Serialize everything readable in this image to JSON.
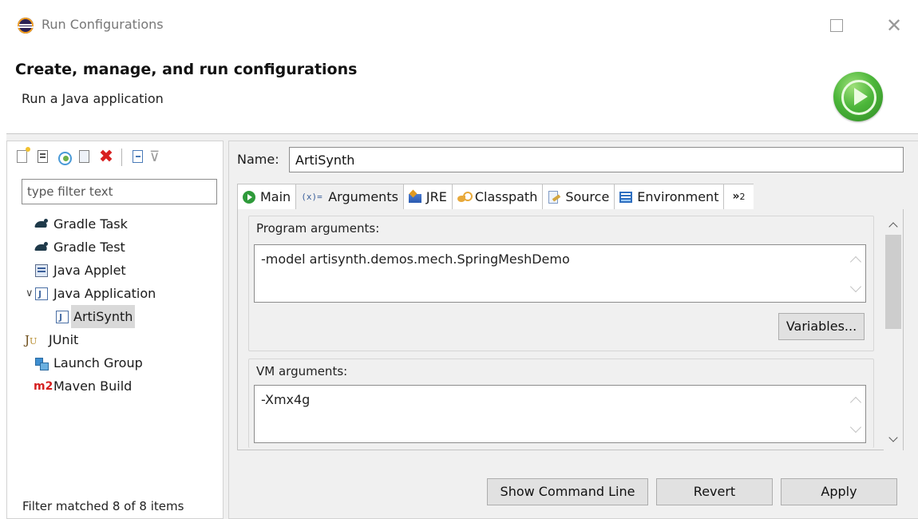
{
  "window": {
    "title": "Run Configurations",
    "maximize_icon": "maximize-icon",
    "close_label": "✕"
  },
  "header": {
    "title": "Create, manage, and run configurations",
    "subtitle": "Run a Java application",
    "icon": "run-icon"
  },
  "left": {
    "toolbar_icons": [
      "new-config-icon",
      "duplicate-icon",
      "export-icon",
      "import-icon",
      "delete-icon",
      "collapse-all-icon",
      "filter-icon"
    ],
    "delete_glyph": "✖",
    "filter_glyph": "⊽",
    "filter": {
      "placeholder": "type filter text",
      "value": ""
    },
    "tree": [
      {
        "label": "Gradle Task",
        "icon": "gradle-icon",
        "level": 1
      },
      {
        "label": "Gradle Test",
        "icon": "gradle-icon",
        "level": 1
      },
      {
        "label": "Java Applet",
        "icon": "java-applet-icon",
        "level": 1
      },
      {
        "label": "Java Application",
        "icon": "java-application-icon",
        "level": 1,
        "expanded": true
      },
      {
        "label": "ArtiSynth",
        "icon": "java-application-icon",
        "level": 2,
        "selected": true
      },
      {
        "label": "JUnit",
        "icon": "junit-icon",
        "level": 1
      },
      {
        "label": "Launch Group",
        "icon": "launch-group-icon",
        "level": 1
      },
      {
        "label": "Maven Build",
        "icon": "maven-icon",
        "level": 1
      }
    ],
    "expand_glyph": "∨",
    "junit_glyph_j": "J",
    "junit_glyph_u": "U",
    "maven_glyph": "m2",
    "status": "Filter matched 8 of 8 items"
  },
  "right": {
    "name_label": "Name:",
    "name_value": "ArtiSynth",
    "tabs": [
      {
        "label": "Main",
        "icon": "main-tab-icon"
      },
      {
        "label": "Arguments",
        "icon": "arguments-tab-icon",
        "active": true
      },
      {
        "label": "JRE",
        "icon": "jre-tab-icon"
      },
      {
        "label": "Classpath",
        "icon": "classpath-tab-icon"
      },
      {
        "label": "Source",
        "icon": "source-tab-icon"
      },
      {
        "label": "Environment",
        "icon": "environment-tab-icon"
      }
    ],
    "args_glyph": "(x)=",
    "overflow_tab": {
      "glyph": "»",
      "count": "2"
    },
    "program_args": {
      "label": "Program arguments:",
      "value": "-model artisynth.demos.mech.SpringMeshDemo"
    },
    "variables_button": "Variables...",
    "vm_args": {
      "label": "VM arguments:",
      "value": "-Xmx4g"
    }
  },
  "buttons": {
    "show_command_line": "Show Command Line",
    "revert": "Revert",
    "apply": "Apply"
  },
  "colors": {
    "run_green": "#4cb63a",
    "delete_red": "#d82020",
    "maven_red": "#d52020"
  }
}
